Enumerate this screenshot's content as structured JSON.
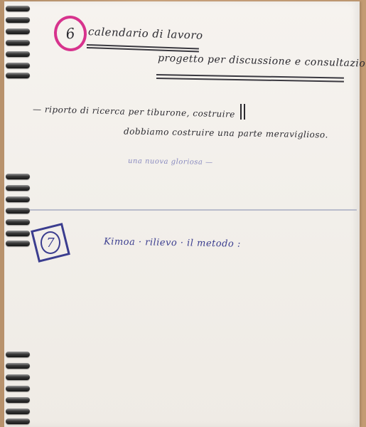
{
  "section6": {
    "number": "6",
    "title": "calendario di lavoro",
    "subtitle": "progetto per discussione e consultazione",
    "line1": "— riporto di ricerca per tiburone, costruire",
    "line2": "dobbiamo costruire una parte meraviglioso.",
    "line3": "una nuova gloriosa —"
  },
  "section7": {
    "number": "7",
    "text": "Kimoa · rilievo · il metodo :"
  },
  "colors": {
    "circle_pink": "#d7338d",
    "ink_blue": "#3b3d8f",
    "ink_black": "#2b2a30",
    "paper": "#f4f1ec"
  }
}
